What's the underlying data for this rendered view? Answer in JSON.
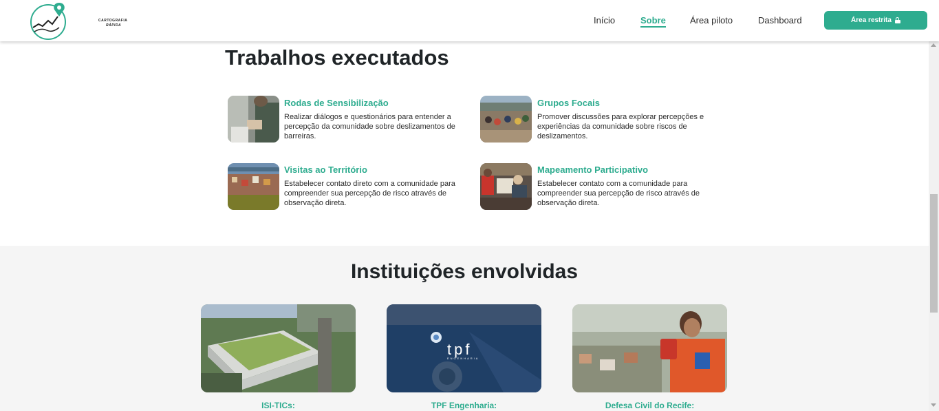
{
  "header": {
    "logo_line1": "CARTOGRAFIA",
    "logo_line2": "RÁPIDA",
    "nav": [
      "Início",
      "Sobre",
      "Área piloto",
      "Dashboard"
    ],
    "active_nav": "Sobre",
    "restricted_button": "Área restrita",
    "accent_color": "#2eac8f"
  },
  "works": {
    "title": "Trabalhos executados",
    "items": [
      {
        "title": "Rodas de Sensibilização",
        "description": "Realizar diálogos e questionários para entender a percepção da comunidade sobre deslizamentos de barreiras."
      },
      {
        "title": "Grupos Focais",
        "description": "Promover discussões para explorar percepções e experiências da comunidade sobre riscos de deslizamentos."
      },
      {
        "title": "Visitas ao Território",
        "description": "Estabelecer contato direto com a comunidade para compreender sua percepção de risco através de observação direta."
      },
      {
        "title": "Mapeamento Participativo",
        "description": "Estabelecer contato com a comunidade para compreender sua percepção de risco através de observação direta."
      }
    ]
  },
  "institutions": {
    "title": "Instituições envolvidas",
    "items": [
      {
        "name": "ISI-TICs:"
      },
      {
        "name": "TPF Engenharia:",
        "logo_text": "tpf",
        "logo_subtext": "ENGENHARIA"
      },
      {
        "name": "Defesa Civil do Recife:"
      }
    ]
  }
}
